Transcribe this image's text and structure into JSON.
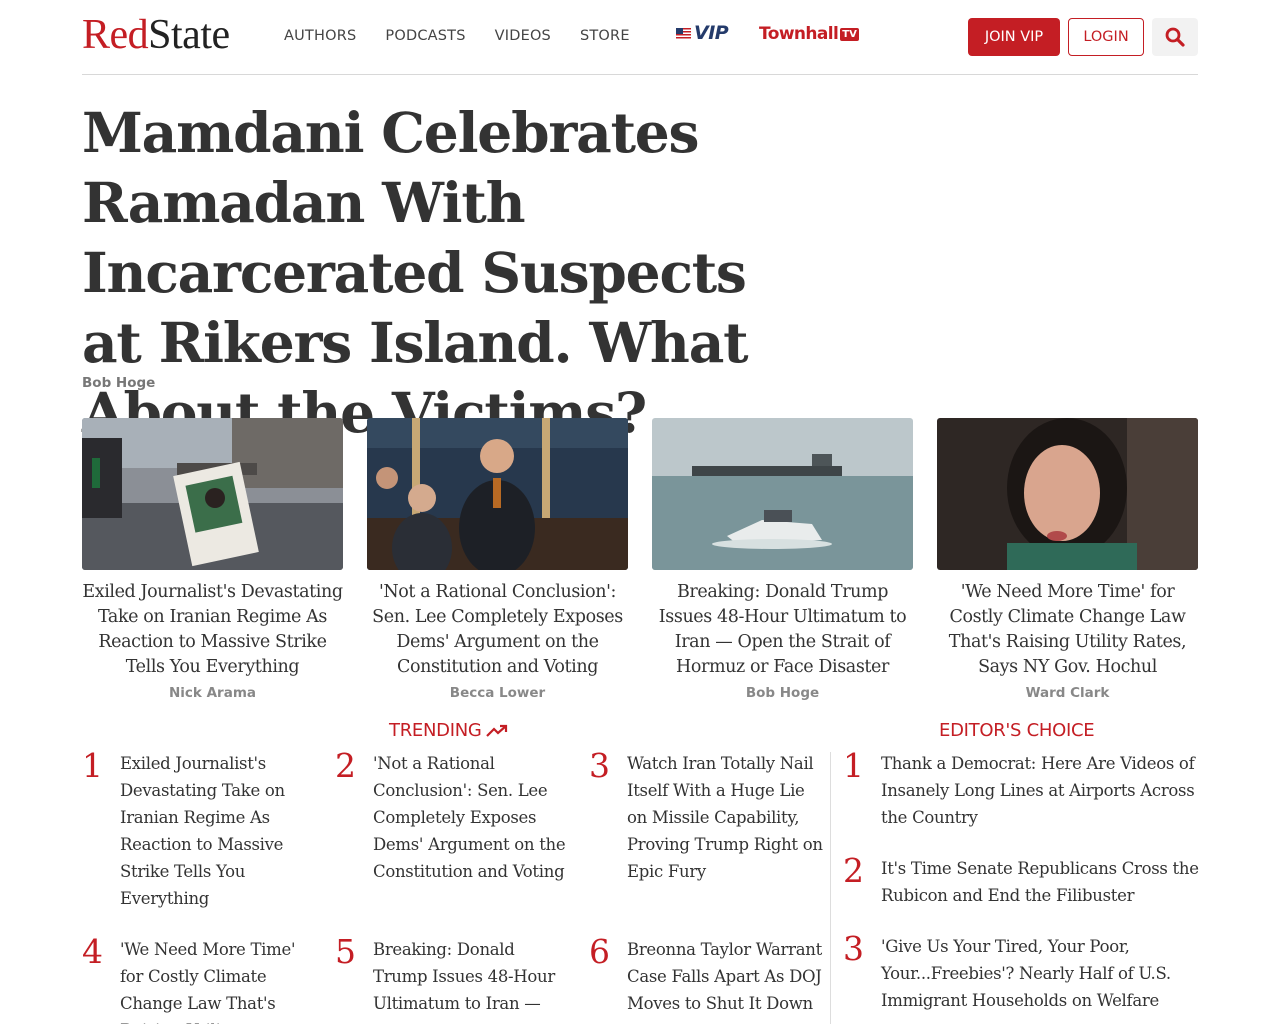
{
  "header": {
    "logo_part1": "Red",
    "logo_part2": "State",
    "nav": [
      "AUTHORS",
      "PODCASTS",
      "VIDEOS",
      "STORE"
    ],
    "vip_label": "VIP",
    "townhall_label": "Townhall",
    "townhall_badge": "TV",
    "join_label": "JOIN VIP",
    "login_label": "LOGIN",
    "accent_color": "#c41e24"
  },
  "article": {
    "headline": "Mamdani Celebrates Ramadan With Incarcerated Suspects at Rikers Island. What About the Victims?",
    "author": "Bob Hoge"
  },
  "cards": [
    {
      "title": "Exiled Journalist's Devastating Take on Iranian Regime As Reaction to Massive Strike Tells You Everything",
      "author": "Nick Arama"
    },
    {
      "title": "'Not a Rational Conclusion': Sen. Lee Completely Exposes Dems' Argument on the Constitution and Voting",
      "author": "Becca Lower"
    },
    {
      "title": "Breaking: Donald Trump Issues 48-Hour Ultimatum to Iran — Open the Strait of Hormuz or Face Disaster",
      "author": "Bob Hoge"
    },
    {
      "title": "'We Need More Time' for Costly Climate Change Law That's Raising Utility Rates, Says NY Gov. Hochul",
      "author": "Ward Clark"
    }
  ],
  "trending": {
    "heading": "TRENDING",
    "items": [
      {
        "num": "1",
        "text": "Exiled Journalist's Devastating Take on Iranian Regime As Reaction to Massive Strike Tells You Everything"
      },
      {
        "num": "2",
        "text": "'Not a Rational Conclusion': Sen. Lee Completely Exposes Dems' Argument on the Constitution and Voting"
      },
      {
        "num": "3",
        "text": "Watch Iran Totally Nail Itself With a Huge Lie on Missile Capability, Proving Trump Right on Epic Fury"
      },
      {
        "num": "4",
        "text": "'We Need More Time' for Costly Climate Change Law That's Raising Utility"
      },
      {
        "num": "5",
        "text": "Breaking: Donald Trump Issues 48-Hour Ultimatum to Iran —"
      },
      {
        "num": "6",
        "text": "Breonna Taylor Warrant Case Falls Apart As DOJ Moves to Shut It Down"
      }
    ]
  },
  "editors_choice": {
    "heading": "EDITOR'S CHOICE",
    "items": [
      {
        "num": "1",
        "text": "Thank a Democrat: Here Are Videos of Insanely Long Lines at Airports Across the Country"
      },
      {
        "num": "2",
        "text": "It's Time Senate Republicans Cross the Rubicon and End the Filibuster"
      },
      {
        "num": "3",
        "text": "'Give Us Your Tired, Your Poor, Your...Freebies'? Nearly Half of U.S. Immigrant Households on Welfare"
      }
    ]
  }
}
